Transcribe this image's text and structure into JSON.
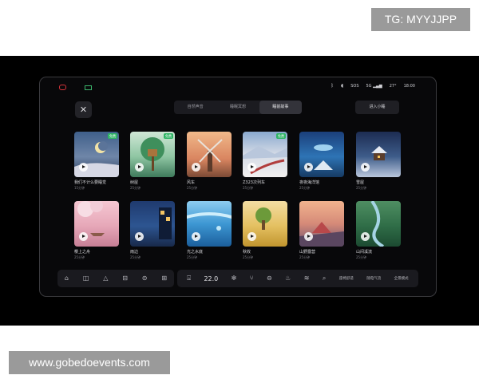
{
  "watermarks": {
    "top": "TG: MYYJJPP",
    "bottom": "www.gobedoevents.com"
  },
  "colors": {
    "accent_green": "#2fb565",
    "status_red": "#d6333a",
    "screen_bg": "#08080a"
  },
  "status_bar": {
    "items": [
      "SOS",
      "5G",
      "27°",
      "18:00"
    ]
  },
  "header": {
    "tabs": [
      {
        "label": "自然声音",
        "active": false
      },
      {
        "label": "睡眠冥想",
        "active": false
      },
      {
        "label": "睡前故事",
        "active": true
      }
    ],
    "enter_button": "进入小睡"
  },
  "cards": [
    {
      "title": "我们不计么要睡觉",
      "sub": "15分钟",
      "badge": "免费"
    },
    {
      "title": "树屋",
      "sub": "25分钟",
      "badge": "免费"
    },
    {
      "title": "风车",
      "sub": "25分钟",
      "badge": ""
    },
    {
      "title": "Z323次列车",
      "sub": "25分钟",
      "badge": "免费"
    },
    {
      "title": "夜夜海洋馆",
      "sub": "25分钟",
      "badge": ""
    },
    {
      "title": "雪屋",
      "sub": "25分钟",
      "badge": ""
    },
    {
      "title": "樱上之舟",
      "sub": "25分钟",
      "badge": ""
    },
    {
      "title": "雨边",
      "sub": "25分钟",
      "badge": ""
    },
    {
      "title": "光之水底",
      "sub": "25分钟",
      "badge": ""
    },
    {
      "title": "秋收",
      "sub": "25分钟",
      "badge": ""
    },
    {
      "title": "山野露营",
      "sub": "25分钟",
      "badge": ""
    },
    {
      "title": "山间溪流",
      "sub": "25分钟",
      "badge": ""
    }
  ],
  "bottom_bar": {
    "temperature": "22.0",
    "labels": [
      "座椅舒适",
      "随电气流",
      "全景模式"
    ]
  },
  "icons": [
    "close-icon",
    "bluetooth-icon",
    "signal-icon",
    "home-icon",
    "car-icon",
    "navigation-icon",
    "seat-icon",
    "fan-icon",
    "defrost-icon",
    "heat-icon"
  ]
}
